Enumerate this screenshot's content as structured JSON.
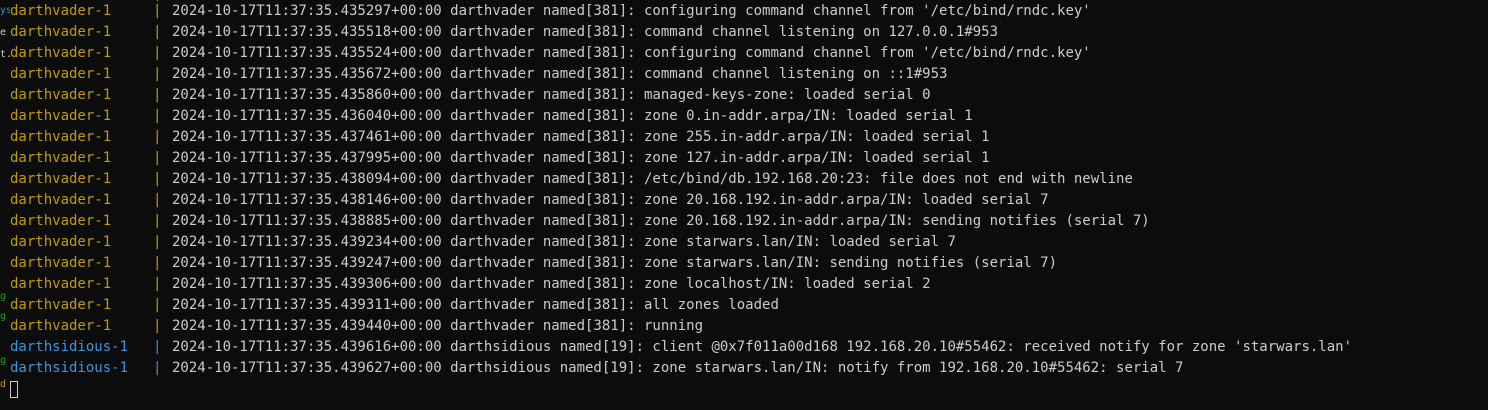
{
  "colors": {
    "background": "#0c0c0c",
    "text": "#cccccc",
    "darthvader": "#c19c00",
    "darthsidious": "#3a96dd"
  },
  "left_margin": [
    "ys",
    "e",
    "t.",
    "g",
    "g",
    "g",
    "d"
  ],
  "separator": "|",
  "lines": [
    {
      "service": "darthvader-1",
      "message": "2024-10-17T11:37:35.435297+00:00 darthvader named[381]: configuring command channel from '/etc/bind/rndc.key'"
    },
    {
      "service": "darthvader-1",
      "message": "2024-10-17T11:37:35.435518+00:00 darthvader named[381]: command channel listening on 127.0.0.1#953"
    },
    {
      "service": "darthvader-1",
      "message": "2024-10-17T11:37:35.435524+00:00 darthvader named[381]: configuring command channel from '/etc/bind/rndc.key'"
    },
    {
      "service": "darthvader-1",
      "message": "2024-10-17T11:37:35.435672+00:00 darthvader named[381]: command channel listening on ::1#953"
    },
    {
      "service": "darthvader-1",
      "message": "2024-10-17T11:37:35.435860+00:00 darthvader named[381]: managed-keys-zone: loaded serial 0"
    },
    {
      "service": "darthvader-1",
      "message": "2024-10-17T11:37:35.436040+00:00 darthvader named[381]: zone 0.in-addr.arpa/IN: loaded serial 1"
    },
    {
      "service": "darthvader-1",
      "message": "2024-10-17T11:37:35.437461+00:00 darthvader named[381]: zone 255.in-addr.arpa/IN: loaded serial 1"
    },
    {
      "service": "darthvader-1",
      "message": "2024-10-17T11:37:35.437995+00:00 darthvader named[381]: zone 127.in-addr.arpa/IN: loaded serial 1"
    },
    {
      "service": "darthvader-1",
      "message": "2024-10-17T11:37:35.438094+00:00 darthvader named[381]: /etc/bind/db.192.168.20:23: file does not end with newline"
    },
    {
      "service": "darthvader-1",
      "message": "2024-10-17T11:37:35.438146+00:00 darthvader named[381]: zone 20.168.192.in-addr.arpa/IN: loaded serial 7"
    },
    {
      "service": "darthvader-1",
      "message": "2024-10-17T11:37:35.438885+00:00 darthvader named[381]: zone 20.168.192.in-addr.arpa/IN: sending notifies (serial 7)"
    },
    {
      "service": "darthvader-1",
      "message": "2024-10-17T11:37:35.439234+00:00 darthvader named[381]: zone starwars.lan/IN: loaded serial 7"
    },
    {
      "service": "darthvader-1",
      "message": "2024-10-17T11:37:35.439247+00:00 darthvader named[381]: zone starwars.lan/IN: sending notifies (serial 7)"
    },
    {
      "service": "darthvader-1",
      "message": "2024-10-17T11:37:35.439306+00:00 darthvader named[381]: zone localhost/IN: loaded serial 2"
    },
    {
      "service": "darthvader-1",
      "message": "2024-10-17T11:37:35.439311+00:00 darthvader named[381]: all zones loaded"
    },
    {
      "service": "darthvader-1",
      "message": "2024-10-17T11:37:35.439440+00:00 darthvader named[381]: running"
    },
    {
      "service": "darthsidious-1",
      "message": "2024-10-17T11:37:35.439616+00:00 darthsidious named[19]: client @0x7f011a00d168 192.168.20.10#55462: received notify for zone 'starwars.lan'"
    },
    {
      "service": "darthsidious-1",
      "message": "2024-10-17T11:37:35.439627+00:00 darthsidious named[19]: zone starwars.lan/IN: notify from 192.168.20.10#55462: serial 7"
    }
  ]
}
